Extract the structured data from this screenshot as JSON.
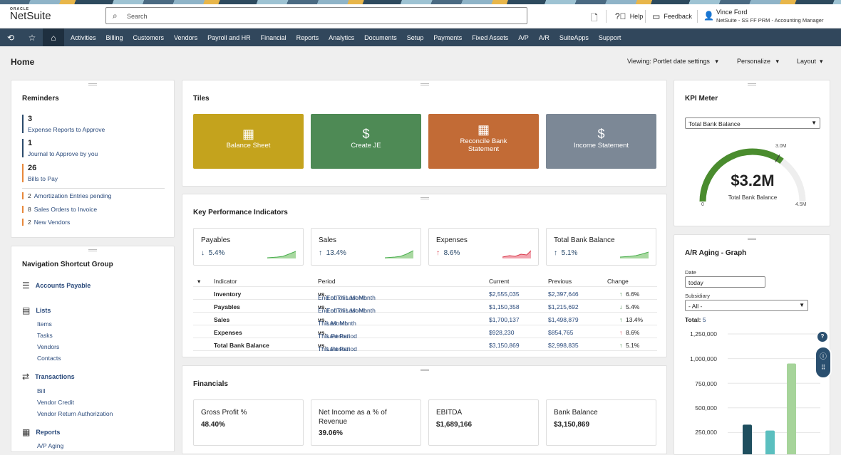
{
  "header": {
    "logo_top": "ORACLE",
    "logo_name": "NetSuite",
    "search_placeholder": "Search",
    "help": "Help",
    "feedback": "Feedback",
    "user_name": "Vince Ford",
    "user_role": "NetSuite - SS FF PRM - Accounting Manager"
  },
  "nav": [
    "Activities",
    "Billing",
    "Customers",
    "Vendors",
    "Payroll and HR",
    "Financial",
    "Reports",
    "Analytics",
    "Documents",
    "Setup",
    "Payments",
    "Fixed Assets",
    "A/P",
    "A/R",
    "SuiteApps",
    "Support"
  ],
  "page": {
    "title": "Home",
    "viewing": "Viewing: Portlet date settings",
    "personalize": "Personalize",
    "layout": "Layout"
  },
  "reminders": {
    "title": "Reminders",
    "items": [
      {
        "count": "3",
        "label": "Expense Reports to Approve"
      },
      {
        "count": "1",
        "label": "Journal to Approve by you"
      },
      {
        "count": "26",
        "label": "Bills to Pay"
      }
    ],
    "minor": [
      {
        "count": "2",
        "label": "Amortization Entries pending"
      },
      {
        "count": "8",
        "label": "Sales Orders to Invoice"
      },
      {
        "count": "2",
        "label": "New Vendors"
      }
    ]
  },
  "nav_group": {
    "title": "Navigation Shortcut Group",
    "accounts_payable": "Accounts Payable",
    "lists": "Lists",
    "list_items": [
      "Items",
      "Tasks",
      "Vendors",
      "Contacts"
    ],
    "transactions": "Transactions",
    "transaction_items": [
      "Bill",
      "Vendor Credit",
      "Vendor Return Authorization"
    ],
    "reports": "Reports",
    "report_items": [
      "A/P Aging"
    ]
  },
  "tiles": {
    "title": "Tiles",
    "items": [
      {
        "label": "Balance Sheet",
        "color": "#c4a31d"
      },
      {
        "label": "Create JE",
        "color": "#4e8a55"
      },
      {
        "label": "Reconcile Bank Statement",
        "color": "#c26b36"
      },
      {
        "label": "Income Statement",
        "color": "#7c8896"
      }
    ]
  },
  "kpi": {
    "title": "Key Performance Indicators",
    "boxes": [
      {
        "name": "Payables",
        "value": "5.4%",
        "dir": "down",
        "color": "#4caf50"
      },
      {
        "name": "Sales",
        "value": "13.4%",
        "dir": "up",
        "color": "#4caf50"
      },
      {
        "name": "Expenses",
        "value": "8.6%",
        "dir": "up",
        "color": "#d83a4a"
      },
      {
        "name": "Total Bank Balance",
        "value": "5.1%",
        "dir": "up",
        "color": "#4caf50"
      }
    ],
    "headers": {
      "indicator": "Indicator",
      "period": "Period",
      "current": "Current",
      "previous": "Previous",
      "change": "Change"
    },
    "rows": [
      {
        "indicator": "Inventory",
        "period_a": "End of This Month",
        "vs": "vs.",
        "period_b": "End of Last Month",
        "current": "$2,555,035",
        "previous": "$2,397,646",
        "change": "6.6%",
        "dir": "up"
      },
      {
        "indicator": "Payables",
        "period_a": "End of This Month",
        "vs": "vs.",
        "period_b": "End of Last Month",
        "current": "$1,150,358",
        "previous": "$1,215,692",
        "change": "5.4%",
        "dir": "down"
      },
      {
        "indicator": "Sales",
        "period_a": "This Month",
        "vs": "vs.",
        "period_b": "Last Month",
        "current": "$1,700,137",
        "previous": "$1,498,879",
        "change": "13.4%",
        "dir": "up"
      },
      {
        "indicator": "Expenses",
        "period_a": "This Period",
        "vs": "vs.",
        "period_b": "Last Period",
        "current": "$928,230",
        "previous": "$854,765",
        "change": "8.6%",
        "dir": "up-red"
      },
      {
        "indicator": "Total Bank Balance",
        "period_a": "This Period",
        "vs": "vs.",
        "period_b": "Last Period",
        "current": "$3,150,869",
        "previous": "$2,998,835",
        "change": "5.1%",
        "dir": "up"
      }
    ]
  },
  "financials": {
    "title": "Financials",
    "boxes": [
      {
        "name": "Gross Profit %",
        "value": "48.40%"
      },
      {
        "name": "Net Income as a % of Revenue",
        "value": "39.06%"
      },
      {
        "name": "EBITDA",
        "value": "$1,689,166"
      },
      {
        "name": "Bank Balance",
        "value": "$3,150,869"
      }
    ]
  },
  "kpi_meter": {
    "title": "KPI Meter",
    "select": "Total Bank Balance",
    "value": "$3.2M",
    "label": "Total Bank Balance",
    "min": "0",
    "max": "4.5M",
    "target": "3.0M",
    "fraction": 0.7
  },
  "ar_aging": {
    "title": "A/R Aging - Graph",
    "date_label": "Date",
    "date_value": "today",
    "subsidiary_label": "Subsidiary",
    "subsidiary_value": "- All -",
    "total_label": "Total:",
    "total_value": "5"
  },
  "chart_data": {
    "type": "bar",
    "yticks": [
      "1,250,000",
      "1,000,000",
      "750,000",
      "500,000",
      "250,000"
    ],
    "ylim": [
      0,
      1250000
    ],
    "values": [
      330000,
      270000,
      950000
    ],
    "colors": [
      "#1f4f5f",
      "#5bbfbf",
      "#a6d49a"
    ]
  }
}
